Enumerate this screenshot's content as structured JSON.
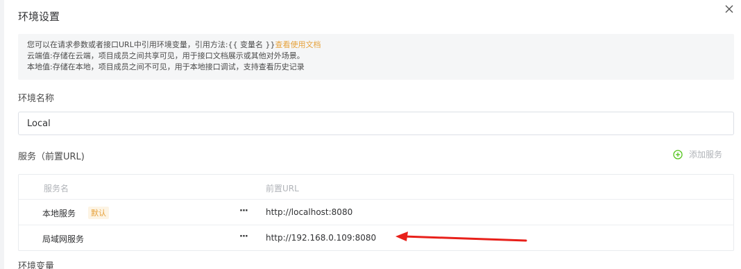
{
  "dialog": {
    "title": "环境设置"
  },
  "notice": {
    "line1_prefix": "您可以在请求参数或者接口URL中引用环境变量，引用方法:{{ 变量名 }}",
    "line1_link": "查看使用文档",
    "line2": "云端值:存储在云端，项目成员之间共享可见，用于接口文档展示或其他对外场景。",
    "line3": "本地值:存储在本地，项目成员之间不可见，用于本地接口调试，支持查看历史记录"
  },
  "env_name": {
    "label": "环境名称",
    "value": "Local"
  },
  "services": {
    "label": "服务（前置URL)",
    "add_label": "添加服务",
    "columns": [
      "服务名",
      "前置URL"
    ],
    "rows": [
      {
        "name": "本地服务",
        "badge": "默认",
        "more": "···",
        "url": "http://localhost:8080"
      },
      {
        "name": "局域网服务",
        "badge": "",
        "more": "···",
        "url": "http://192.168.0.109:8080"
      }
    ]
  },
  "env_vars": {
    "label": "环境变量"
  },
  "colors": {
    "accent": "#e6a23c",
    "add_icon": "#52c41a",
    "arrow": "#e8201a"
  },
  "icons": {
    "close": "close-icon",
    "add": "plus-circle-icon",
    "more": "ellipsis-icon"
  }
}
